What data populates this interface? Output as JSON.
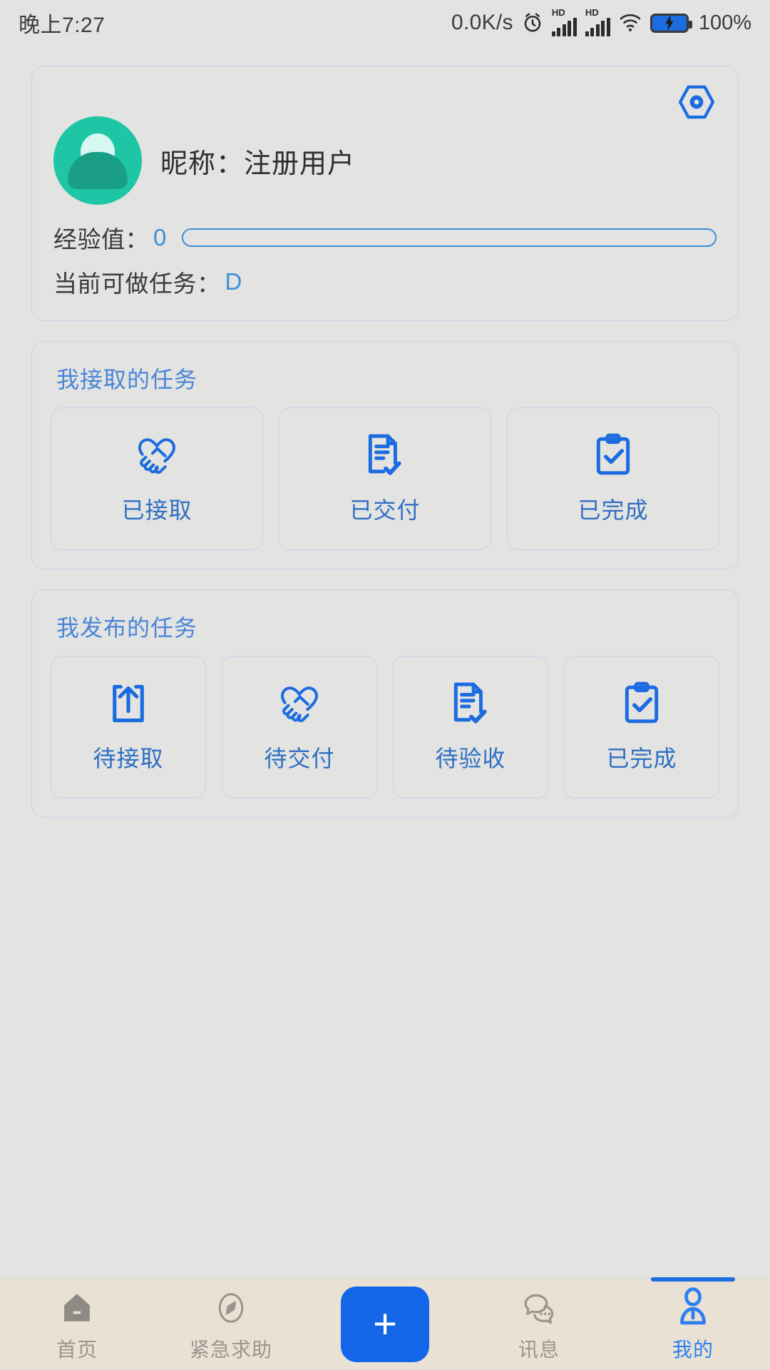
{
  "statusbar": {
    "time": "晚上7:27",
    "network_speed": "0.0K/s",
    "alarm_icon": "alarm-clock-icon",
    "sim1_label": "HD",
    "sim2_label": "HD",
    "wifi_icon": "wifi-icon",
    "battery_icon": "battery-charging-icon",
    "battery_percent": "100%"
  },
  "profile": {
    "eye_icon": "hexagon-eye-icon",
    "avatar_icon": "user-avatar",
    "nickname_label": "昵称：",
    "nickname_value": "注册用户",
    "exp_label": "经验值：",
    "exp_value": "0",
    "exp_progress_percent": 0,
    "level_label": "当前可做任务：",
    "level_value": "D"
  },
  "accepted_tasks": {
    "title": "我接取的任务",
    "tiles": [
      {
        "label": "已接取",
        "icon": "handshake-icon"
      },
      {
        "label": "已交付",
        "icon": "document-check-icon"
      },
      {
        "label": "已完成",
        "icon": "clipboard-check-icon"
      }
    ]
  },
  "published_tasks": {
    "title": "我发布的任务",
    "tiles": [
      {
        "label": "待接取",
        "icon": "upload-box-icon"
      },
      {
        "label": "待交付",
        "icon": "handshake-icon"
      },
      {
        "label": "待验收",
        "icon": "document-check-icon"
      },
      {
        "label": "已完成",
        "icon": "clipboard-check-icon"
      }
    ]
  },
  "navbar": {
    "items": [
      {
        "label": "首页",
        "icon": "home-icon",
        "active": false
      },
      {
        "label": "紧急求助",
        "icon": "compass-icon",
        "active": false
      },
      {
        "label": "",
        "icon": "plus-icon",
        "active": false
      },
      {
        "label": "讯息",
        "icon": "chat-bubbles-icon",
        "active": false
      },
      {
        "label": "我的",
        "icon": "person-icon",
        "active": true
      }
    ]
  },
  "colors": {
    "page_background": "#e3e3e1",
    "accent_blue": "#1b6ce0",
    "label_blue": "#4a86d8",
    "border_blue": "#c3d4ef",
    "avatar_green": "#1fc6a6",
    "navbar_background": "#e9e1d4",
    "nav_inactive": "#9a968e"
  }
}
